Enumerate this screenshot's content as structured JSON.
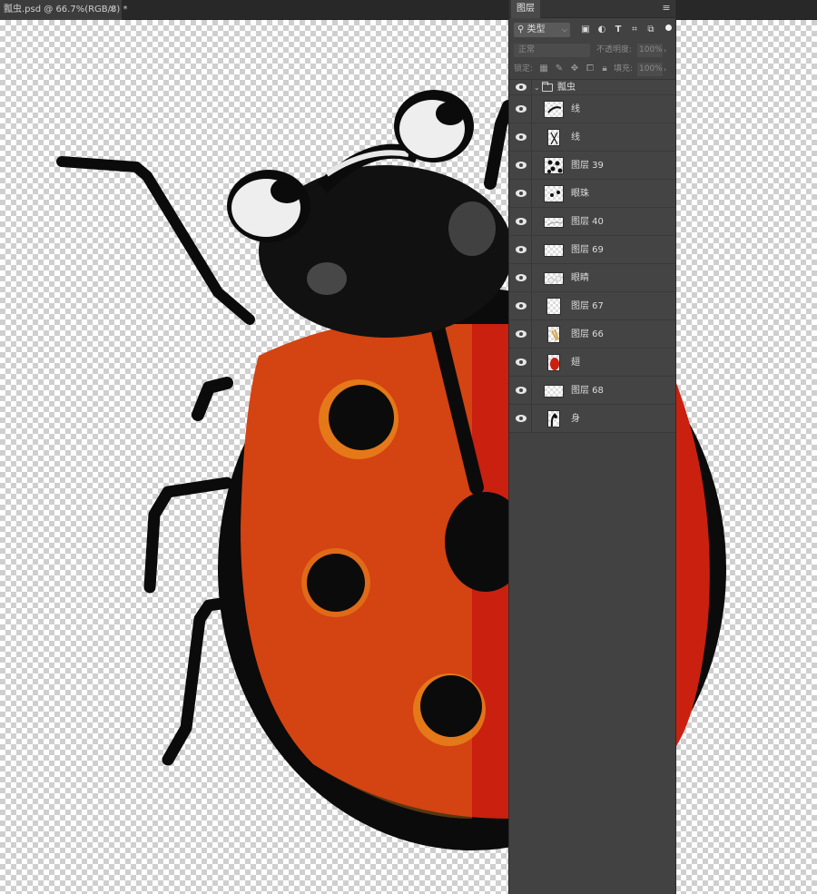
{
  "document_tab": {
    "title": "瓢虫.psd @ 66.7%(RGB/8) *",
    "close": "×"
  },
  "layers_panel": {
    "tab_label": "图层",
    "menu_icon": "≡",
    "filter": {
      "kind_label": "类型",
      "icons": [
        "image-filter-icon",
        "adjustment-filter-icon",
        "type-filter-icon",
        "shape-filter-icon",
        "smart-object-filter-icon"
      ]
    },
    "blend_mode": "正常",
    "opacity_label": "不透明度:",
    "opacity_value": "100%",
    "lock_label": "锁定:",
    "lock_icons": [
      "lock-transparent-icon",
      "lock-image-icon",
      "lock-position-icon",
      "lock-artboard-icon",
      "lock-all-icon"
    ],
    "fill_label": "填充:",
    "fill_value": "100%",
    "group": {
      "name": "瓢虫"
    },
    "layers": [
      {
        "name": "线"
      },
      {
        "name": "线"
      },
      {
        "name": "图层 39"
      },
      {
        "name": "眼珠"
      },
      {
        "name": "图层 40"
      },
      {
        "name": "图层 69"
      },
      {
        "name": "眼睛"
      },
      {
        "name": "图层 67"
      },
      {
        "name": "图层 66"
      },
      {
        "name": "翅"
      },
      {
        "name": "图层 68"
      },
      {
        "name": "身"
      }
    ]
  },
  "colors": {
    "shell_red": "#c9200f",
    "shell_orange": "#e8861a",
    "ink_black": "#0b0b0b",
    "panel_bg": "#424242"
  }
}
